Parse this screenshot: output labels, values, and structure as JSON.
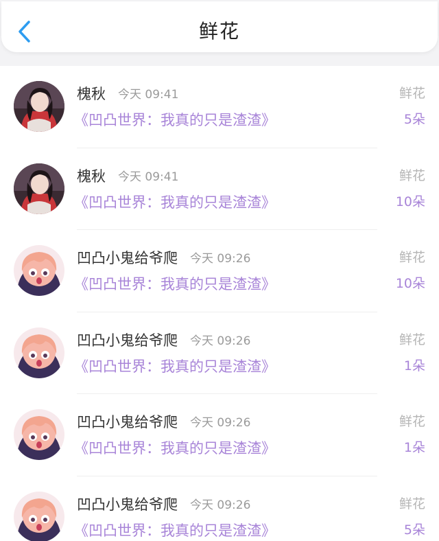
{
  "header": {
    "title": "鲜花",
    "back_icon": "chevron-left-icon",
    "accent_color": "#2d9cf0"
  },
  "colors": {
    "purple": "#a884d8",
    "gray_text": "#9a9a9a"
  },
  "records": [
    {
      "user": "槐秋",
      "time": "今天 09:41",
      "book": "《凹凸世界：我真的只是渣渣》",
      "type": "鲜花",
      "amount": "5朵",
      "avatar": "girl-photo"
    },
    {
      "user": "槐秋",
      "time": "今天 09:41",
      "book": "《凹凸世界：我真的只是渣渣》",
      "type": "鲜花",
      "amount": "10朵",
      "avatar": "girl-photo"
    },
    {
      "user": "凹凸小鬼给爷爬",
      "time": "今天 09:26",
      "book": "《凹凸世界：我真的只是渣渣》",
      "type": "鲜花",
      "amount": "10朵",
      "avatar": "anime-girl"
    },
    {
      "user": "凹凸小鬼给爷爬",
      "time": "今天 09:26",
      "book": "《凹凸世界：我真的只是渣渣》",
      "type": "鲜花",
      "amount": "1朵",
      "avatar": "anime-girl"
    },
    {
      "user": "凹凸小鬼给爷爬",
      "time": "今天 09:26",
      "book": "《凹凸世界：我真的只是渣渣》",
      "type": "鲜花",
      "amount": "1朵",
      "avatar": "anime-girl"
    },
    {
      "user": "凹凸小鬼给爷爬",
      "time": "今天 09:26",
      "book": "《凹凸世界：我真的只是渣渣》",
      "type": "鲜花",
      "amount": "5朵",
      "avatar": "anime-girl"
    }
  ]
}
